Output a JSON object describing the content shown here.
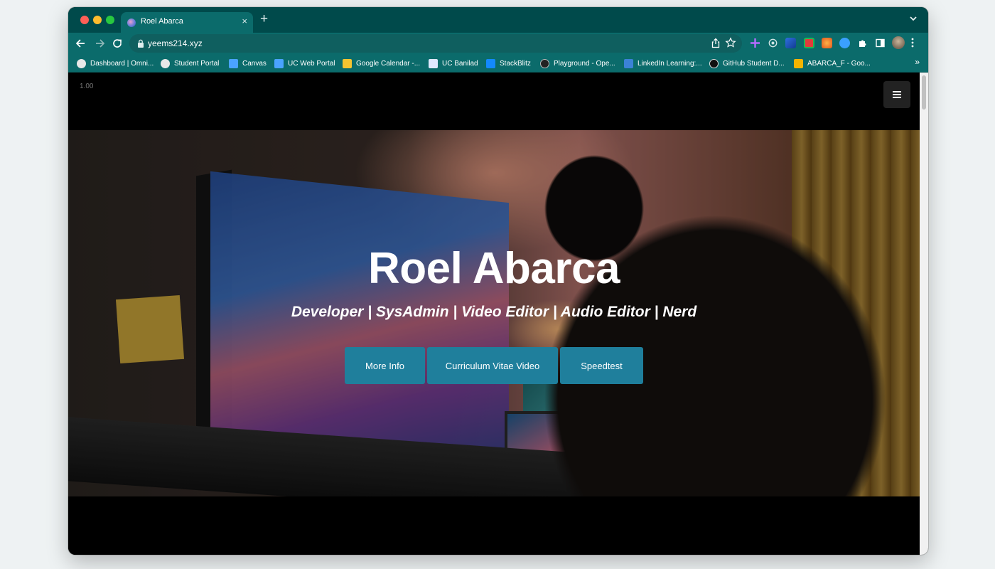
{
  "browser": {
    "tab": {
      "title": "Roel Abarca",
      "close": "×"
    },
    "new_tab": "+",
    "address": {
      "url": "yeems214.xyz"
    },
    "bookmarks": [
      {
        "label": "Dashboard | Omni...",
        "icon": "globe-icon",
        "color": "#e8e8e8"
      },
      {
        "label": "Student Portal",
        "icon": "globe-icon",
        "color": "#e8e8e8"
      },
      {
        "label": "Canvas",
        "icon": "canvas-icon",
        "color": "#4aa3ff"
      },
      {
        "label": "UC Web Portal",
        "icon": "uc-icon",
        "color": "#4aa3ff"
      },
      {
        "label": "Google Calendar -...",
        "icon": "calendar-icon",
        "color": "#f4c430"
      },
      {
        "label": "UC Banilad",
        "icon": "uc-banilad-icon",
        "color": "#dfe8ff"
      },
      {
        "label": "StackBlitz",
        "icon": "stackblitz-icon",
        "color": "#1389fd"
      },
      {
        "label": "Playground - Ope...",
        "icon": "openai-icon",
        "color": "#222222"
      },
      {
        "label": "LinkedIn Learning:...",
        "icon": "linkedin-learning-icon",
        "color": "#3b82d6"
      },
      {
        "label": "GitHub Student D...",
        "icon": "github-icon",
        "color": "#111111"
      },
      {
        "label": "ABARCA_F - Goo...",
        "icon": "google-drive-icon",
        "color": "#f4b400"
      }
    ],
    "bookmarks_more": "»"
  },
  "page": {
    "zoom_label": "1.00",
    "hero": {
      "title": "Roel Abarca",
      "subtitle": "Developer | SysAdmin | Video Editor | Audio Editor | Nerd",
      "buttons": [
        {
          "label": "More Info"
        },
        {
          "label": "Curriculum Vitae Video"
        },
        {
          "label": "Speedtest"
        }
      ]
    }
  },
  "colors": {
    "chrome_dark": "#004a4b",
    "chrome": "#0b6b6b",
    "button": "#1f7f9c"
  }
}
